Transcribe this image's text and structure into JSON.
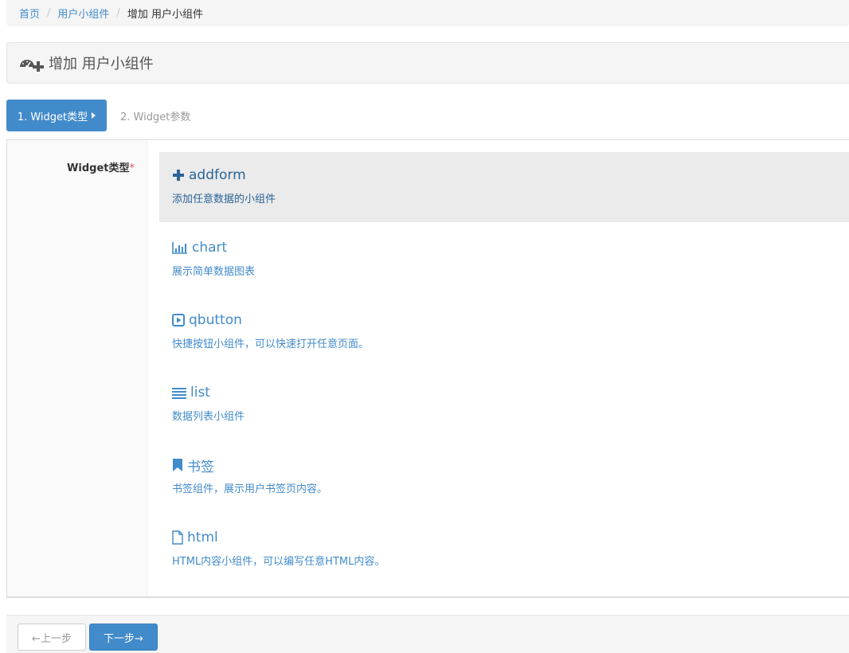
{
  "breadcrumb": {
    "items": [
      "首页",
      "用户小组件"
    ],
    "separator": "/",
    "current": "增加 用户小组件"
  },
  "page": {
    "title": "增加 用户小组件",
    "title_icon": "dashboard-plus-icon"
  },
  "wizard": {
    "steps": [
      {
        "label": "1. Widget类型",
        "active": true
      },
      {
        "label": "2. Widget参数",
        "active": false
      }
    ]
  },
  "form": {
    "field_label": "Widget类型",
    "required_mark": "*",
    "options": [
      {
        "name": "addform",
        "desc": "添加任意数据的小组件",
        "icon": "plus-icon",
        "selected": true
      },
      {
        "name": "chart",
        "desc": "展示简单数据图表",
        "icon": "bar-chart-icon",
        "selected": false
      },
      {
        "name": "qbutton",
        "desc": "快捷按钮小组件，可以快速打开任意页面。",
        "icon": "play-square-icon",
        "selected": false
      },
      {
        "name": "list",
        "desc": "数据列表小组件",
        "icon": "list-icon",
        "selected": false
      },
      {
        "name": "书签",
        "desc": "书签组件，展示用户书签页内容。",
        "icon": "bookmark-icon",
        "selected": false
      },
      {
        "name": "html",
        "desc": "HTML内容小组件，可以编写任意HTML内容。",
        "icon": "file-icon",
        "selected": false
      }
    ]
  },
  "footer": {
    "prev_label": "←上一步",
    "next_label": "下一步→"
  },
  "colors": {
    "primary": "#428bca",
    "primary_dark": "#2a6496",
    "selected_bg": "#ebebeb",
    "required": "#d9534f"
  }
}
